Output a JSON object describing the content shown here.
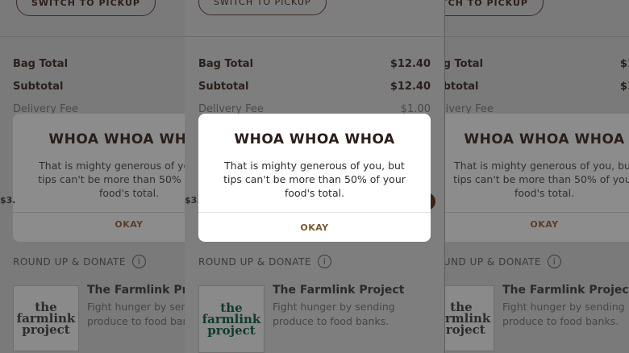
{
  "order": {
    "switch_label": "SWITCH TO PICKUP",
    "bag_total_label": "Bag Total",
    "bag_total_value": "$12.40",
    "subtotal_label": "Subtotal",
    "subtotal_value": "$12.40",
    "delivery_fee_label": "Delivery Fee",
    "delivery_fee_value": "$1.00"
  },
  "dialog": {
    "title": "WHOA WHOA WHOA",
    "message": "That is mighty generous of you, but tips can't be more than 50% of your food's total.",
    "ok_label": "OKAY"
  },
  "donate": {
    "section_label": "ROUND UP & DONATE",
    "info_glyph": "i",
    "logo_text": "the farmlink project",
    "name": "The Farmlink Project",
    "description": "Fight hunger by sending produce to food banks."
  },
  "side_fragment": "$3.",
  "colors": {
    "dialog_accent": "#7a5a2e",
    "title_color": "#2a1d1a",
    "logo_green": "#0f3b2a"
  }
}
